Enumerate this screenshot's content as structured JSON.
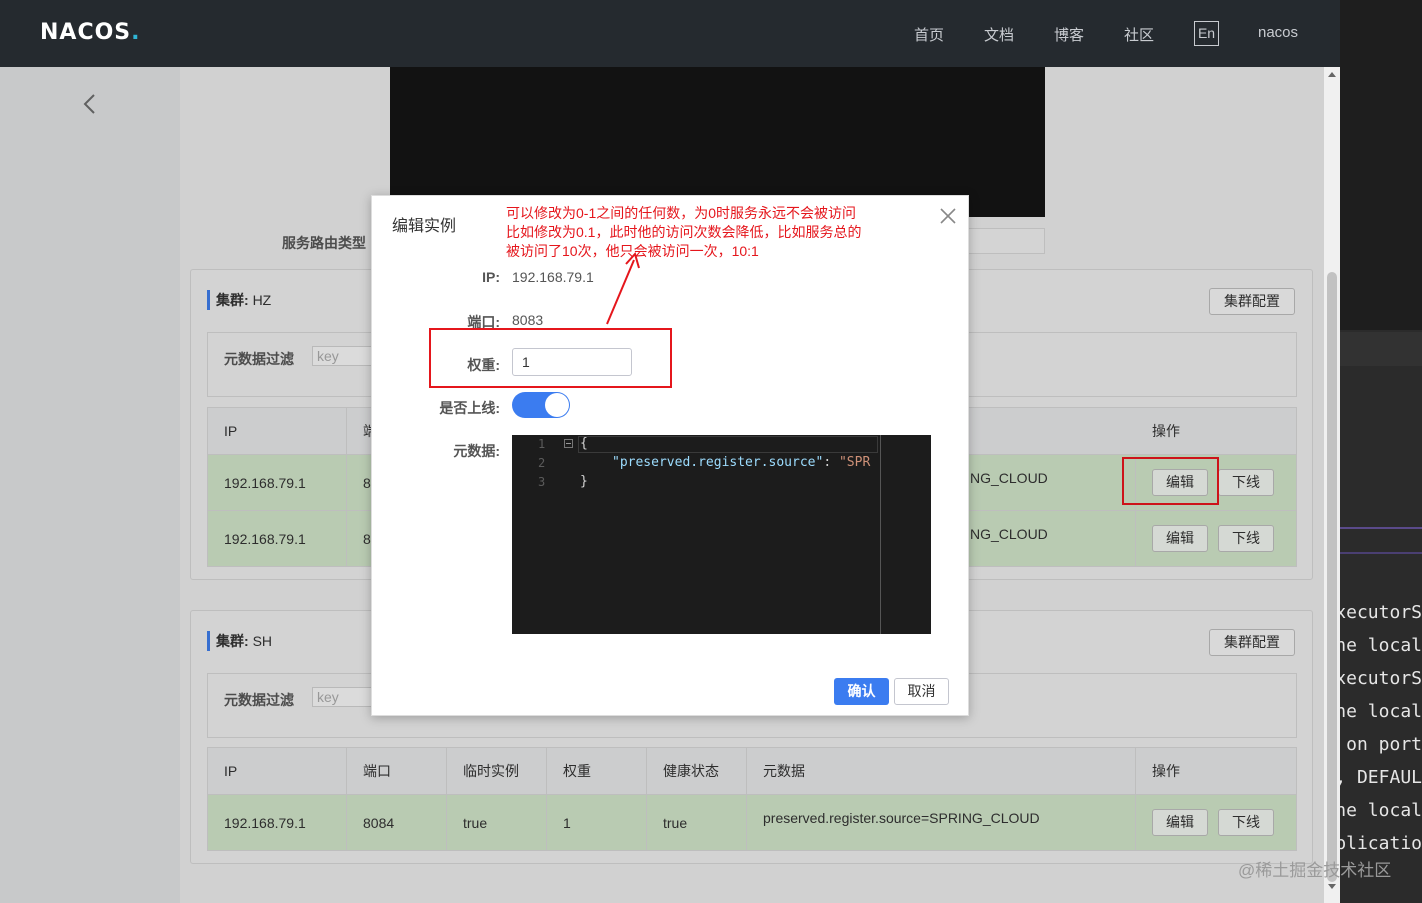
{
  "nav": {
    "logo": "NACOS",
    "logo_dot": ".",
    "items": [
      "首页",
      "文档",
      "博客",
      "社区"
    ],
    "lang": "En",
    "user": "nacos"
  },
  "route_label": "服务路由类型",
  "clusters": [
    {
      "title_prefix": "集群:",
      "name": "HZ",
      "config_button": "集群配置",
      "filter_label": "元数据过滤",
      "filter_placeholder": "key",
      "headers": [
        "IP",
        "端",
        "",
        "",
        "",
        "",
        "操作"
      ],
      "rows": [
        {
          "ip": "192.168.79.1",
          "port": "8",
          "metadata": "NG_CLOUD",
          "edit": "编辑",
          "offline": "下线"
        },
        {
          "ip": "192.168.79.1",
          "port": "8",
          "metadata": "NG_CLOUD",
          "edit": "编辑",
          "offline": "下线"
        }
      ]
    },
    {
      "title_prefix": "集群:",
      "name": "SH",
      "config_button": "集群配置",
      "filter_label": "元数据过滤",
      "filter_placeholder": "key",
      "headers": [
        "IP",
        "端口",
        "临时实例",
        "权重",
        "健康状态",
        "元数据",
        "操作"
      ],
      "rows": [
        {
          "ip": "192.168.79.1",
          "port": "8084",
          "ephemeral": "true",
          "weight": "1",
          "healthy": "true",
          "metadata": "preserved.register.source=SPRING_CLOUD",
          "edit": "编辑",
          "offline": "下线"
        }
      ]
    }
  ],
  "modal": {
    "title": "编辑实例",
    "annotation": [
      "可以修改为0-1之间的任何数，为0时服务永远不会被访问",
      "比如修改为0.1，此时他的访问次数会降低，比如服务总的",
      "被访问了10次，他只会被访问一次，10:1"
    ],
    "ip_label": "IP:",
    "ip_value": "192.168.79.1",
    "port_label": "端口:",
    "port_value": "8083",
    "weight_label": "权重:",
    "weight_value": "1",
    "online_label": "是否上线:",
    "online": true,
    "metadata_label": "元数据:",
    "editor_lines": [
      "1",
      "2",
      "3"
    ],
    "code_open": "{",
    "code_key": "\"preserved.register.source\"",
    "code_colon": ": ",
    "code_value": "\"SPR",
    "code_close": "}",
    "confirm": "确认",
    "cancel": "取消"
  },
  "terminal_lines": [
    "xecutorS",
    "he local",
    "xecutorS",
    "he local",
    " on port",
    ", DEFAUL",
    "he local",
    "plicatio"
  ],
  "watermark": "@稀土掘金技术社区",
  "colors": {
    "accent": "#3b7cf0",
    "annotation": "#e5161c",
    "healthy_row": "#cfe2c7"
  }
}
